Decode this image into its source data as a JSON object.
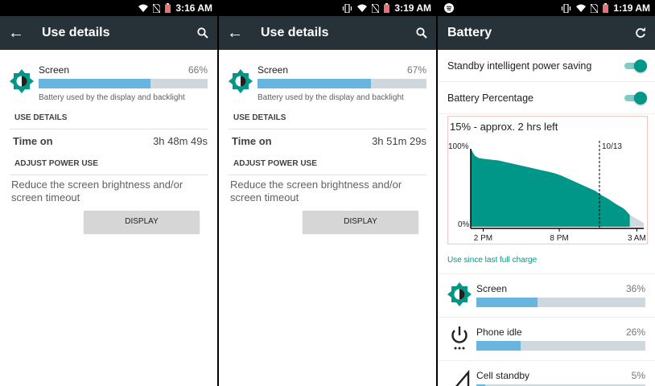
{
  "panel1": {
    "status": {
      "time": "3:16 AM"
    },
    "toolbar": {
      "title": "Use details"
    },
    "screen": {
      "label": "Screen",
      "percent": "66%",
      "fill": 0.66,
      "description": "Battery used by the display and backlight"
    },
    "use_details_header": "USE DETAILS",
    "time_on": {
      "label": "Time on",
      "value": "3h 48m 49s"
    },
    "adjust_header": "ADJUST POWER USE",
    "advice": "Reduce the screen brightness and/or screen timeout",
    "button": "DISPLAY"
  },
  "panel2": {
    "status": {
      "time": "3:19 AM"
    },
    "toolbar": {
      "title": "Use details"
    },
    "screen": {
      "label": "Screen",
      "percent": "67%",
      "fill": 0.67,
      "description": "Battery used by the display and backlight"
    },
    "use_details_header": "USE DETAILS",
    "time_on": {
      "label": "Time on",
      "value": "3h 51m 29s"
    },
    "adjust_header": "ADJUST POWER USE",
    "advice": "Reduce the screen brightness and/or screen timeout",
    "button": "DISPLAY"
  },
  "panel3": {
    "status": {
      "time": "1:19 AM"
    },
    "toolbar": {
      "title": "Battery"
    },
    "settings": [
      {
        "label": "Standby intelligent power saving",
        "on": true
      },
      {
        "label": "Battery Percentage",
        "on": true
      }
    ],
    "chart_title": "15% - approx. 2 hrs left",
    "since": "Use since last full charge",
    "items": [
      {
        "label": "Screen",
        "percent": "36%",
        "fill": 0.36,
        "icon": "brightness-icon"
      },
      {
        "label": "Phone idle",
        "percent": "26%",
        "fill": 0.26,
        "icon": "power-icon"
      },
      {
        "label": "Cell standby",
        "percent": "5%",
        "fill": 0.05,
        "icon": "cell-signal-icon"
      }
    ]
  },
  "colors": {
    "toolbar": "#263238",
    "accent": "#009688",
    "bar_fill": "#6ab4e0",
    "bar_track": "#cfd8dc"
  },
  "chart_data": {
    "type": "area",
    "title": "15% - approx. 2 hrs left",
    "ylabels": [
      "100%",
      "0%"
    ],
    "xlabels": [
      "2 PM",
      "8 PM",
      "3 AM"
    ],
    "marker_label": "10/13",
    "ylim": [
      0,
      100
    ],
    "x": [
      0,
      0.3,
      0.6,
      1,
      1.5,
      2,
      2.5,
      3,
      3.5,
      4,
      4.5,
      5,
      5.5,
      6,
      6.5,
      7,
      7.5,
      8,
      8.5,
      9,
      9.5,
      10,
      10.5,
      11,
      11.2,
      11.5,
      12,
      12.5
    ],
    "values": [
      100,
      91,
      88,
      87,
      86,
      85,
      83,
      81,
      79,
      77,
      75,
      73,
      71,
      69,
      66,
      62,
      58,
      54,
      50,
      46,
      40,
      35,
      29,
      24,
      21,
      15,
      10,
      5
    ],
    "projected_to_x": 12.5,
    "grid": false
  }
}
